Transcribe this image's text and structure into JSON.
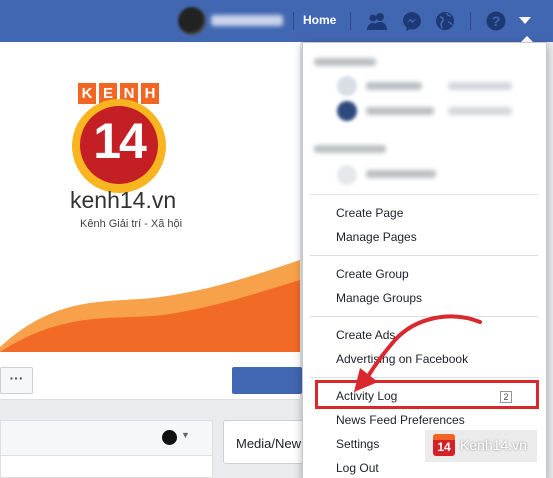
{
  "topbar": {
    "home_label": "Home"
  },
  "cover": {
    "brand_tiles": [
      "K",
      "E",
      "N",
      "H"
    ],
    "brand_number": "14",
    "brand_site": "kenh14.vn",
    "brand_tagline": "Kênh Giải trí - Xã hội"
  },
  "page_actions": {
    "more_label": "···"
  },
  "composer": {
    "media_label": "Media/New"
  },
  "menu": {
    "group1": [
      "Create Page",
      "Manage Pages"
    ],
    "group2": [
      "Create Group",
      "Manage Groups"
    ],
    "group3": [
      "Create Ads",
      "Advertising on Facebook"
    ],
    "activity_log": {
      "label": "Activity Log",
      "badge": "2"
    },
    "group4": [
      "News Feed Preferences",
      "Settings",
      "Log Out"
    ]
  },
  "watermark": {
    "number": "14",
    "text": "Kenh14.vn"
  },
  "colors": {
    "facebook_blue": "#4267b2",
    "highlight_red": "#d9282e",
    "brand_orange": "#f26522",
    "brand_red": "#c41f24",
    "brand_yellow": "#f9b520"
  }
}
